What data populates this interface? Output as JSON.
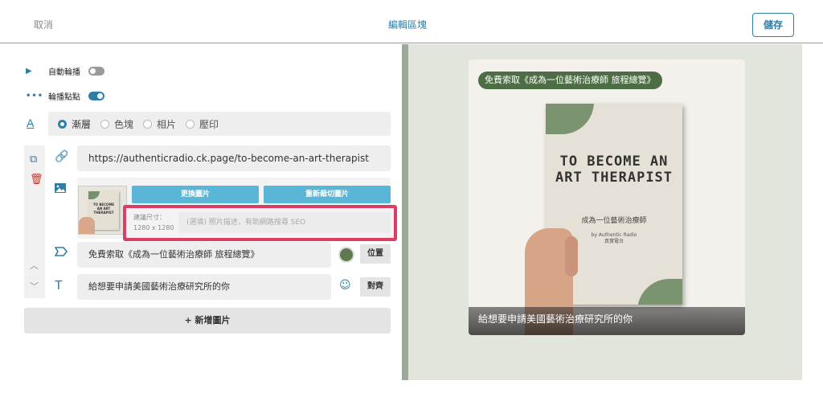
{
  "header": {
    "cancel_label": "取消",
    "title": "編輯區塊",
    "save_label": "儲存"
  },
  "settings": {
    "autoplay_label": "自動輪播",
    "autoplay_on": false,
    "dots_label": "輪播點點",
    "dots_on": true
  },
  "caption_style": {
    "options": [
      "漸層",
      "色塊",
      "相片",
      "壓印"
    ],
    "selected": "漸層"
  },
  "slide": {
    "url": "https://authenticradio.ck.page/to-become-an-art-therapist",
    "replace_image_label": "更換圖片",
    "recrop_image_label": "重新裁切圖片",
    "size_hint_label": "建議尺寸：",
    "size_hint_value": "1280 x 1280",
    "alt_placeholder": "(選填) 照片描述，有助網路搜尋 SEO",
    "badge_text": "免費索取《成為一位藝術治療師 旅程總覽》",
    "badge_color": "#5e7a4f",
    "position_label": "位置",
    "caption_text": "給想要申請美國藝術治療研究所的你",
    "align_label": "對齊"
  },
  "add_image_label": "+ 新增圖片",
  "preview": {
    "badge_text": "免費索取《成為一位藝術治療師 旅程總覽》",
    "book_title": "TO BECOME AN ART THERAPIST",
    "book_subtitle": "成為一位藝術治療師",
    "book_author": "by Authentic Radio",
    "book_author_cn": "真實電台",
    "caption_text": "給想要申請美國藝術治療研究所的你"
  },
  "colors": {
    "accent": "#2f7ea6",
    "highlight": "#dc3d63",
    "button_blue": "#5ab6d6",
    "badge_green": "#4d6e45"
  },
  "icons": [
    "play-icon",
    "dots-icon",
    "text-style-icon",
    "copy-icon",
    "trash-icon",
    "link-icon",
    "image-icon",
    "tag-icon",
    "text-icon",
    "emoji-icon",
    "chevron-up-icon",
    "chevron-down-icon"
  ]
}
